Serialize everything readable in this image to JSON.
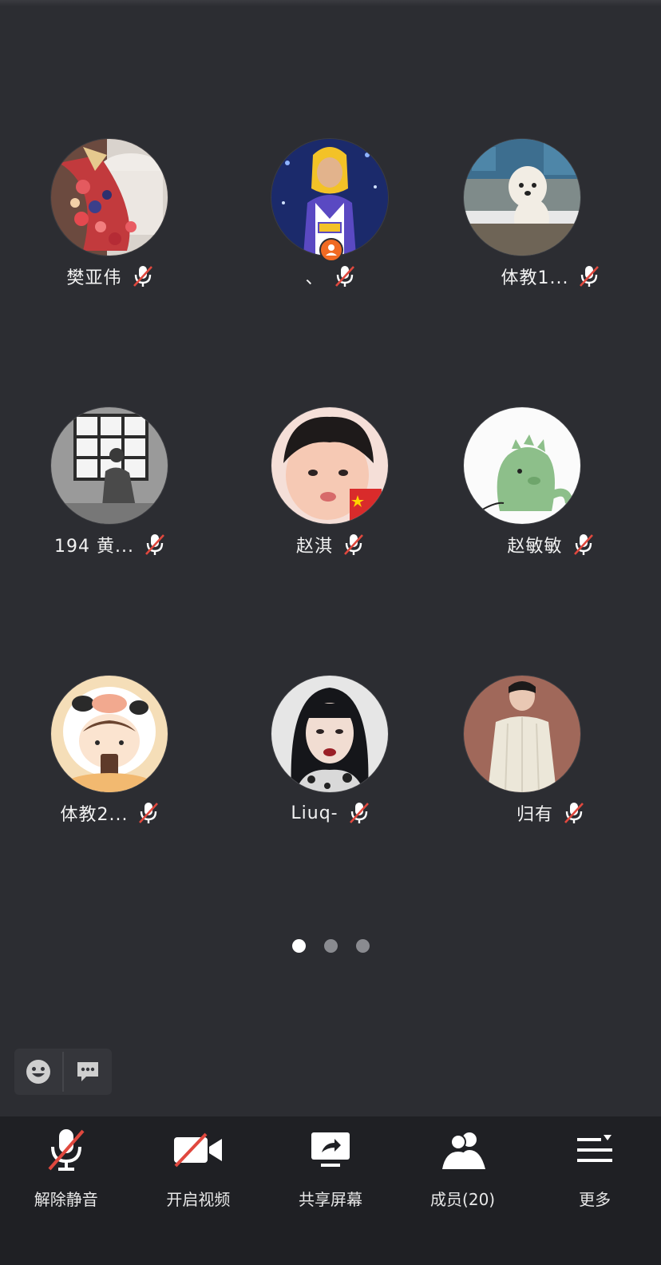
{
  "participants": [
    {
      "name": "樊亚伟",
      "muted": true,
      "host": false,
      "avatar_icon": "cake-avatar"
    },
    {
      "name": "、",
      "muted": true,
      "host": true,
      "avatar_icon": "lakers-hoodie-avatar"
    },
    {
      "name": "体教1...",
      "muted": true,
      "host": false,
      "avatar_icon": "white-dog-avatar"
    },
    {
      "name": "194 黄...",
      "muted": true,
      "host": false,
      "avatar_icon": "window-silhouette-avatar"
    },
    {
      "name": "赵淇",
      "muted": true,
      "host": false,
      "avatar_icon": "child-face-avatar"
    },
    {
      "name": "赵敏敏",
      "muted": true,
      "host": false,
      "avatar_icon": "green-dinosaur-avatar"
    },
    {
      "name": "体教2...",
      "muted": true,
      "host": false,
      "avatar_icon": "cow-costume-cartoon-avatar"
    },
    {
      "name": "Liuq-",
      "muted": true,
      "host": false,
      "avatar_icon": "girl-portrait-avatar"
    },
    {
      "name": "归有",
      "muted": true,
      "host": false,
      "avatar_icon": "man-sweater-avatar"
    }
  ],
  "pager": {
    "pages": 3,
    "active": 0
  },
  "quick_bar": {
    "emoji_icon": "emoji-face-icon",
    "chat_icon": "chat-bubble-icon"
  },
  "toolbar": {
    "unmute_label": "解除静音",
    "video_label": "开启视频",
    "share_label": "共享屏幕",
    "members_label": "成员(20)",
    "more_label": "更多"
  },
  "colors": {
    "background": "#2c2d32",
    "toolbar": "#1f2024",
    "mute_slash": "#e0483e",
    "host_badge": "#f06a23"
  }
}
